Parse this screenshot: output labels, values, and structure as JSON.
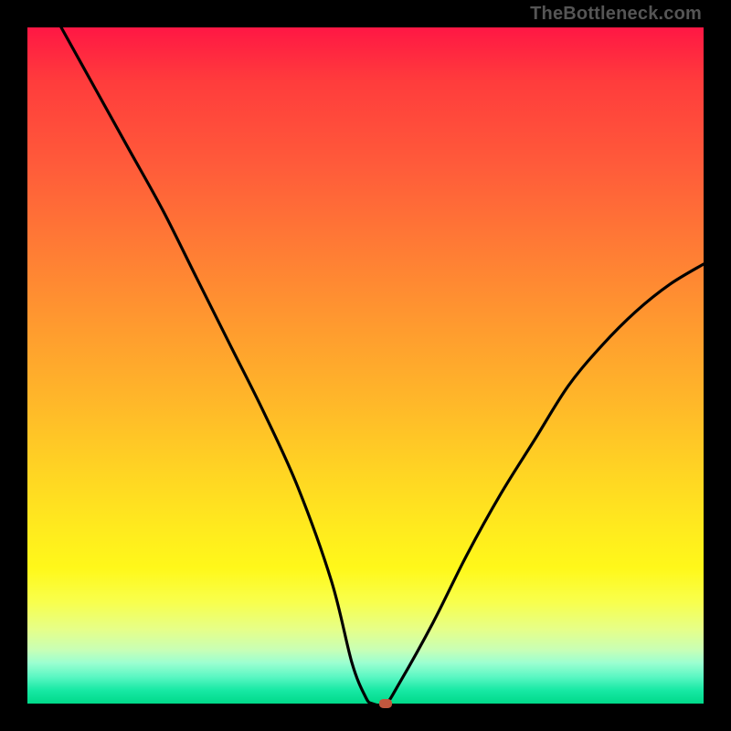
{
  "watermark": "TheBottleneck.com",
  "chart_data": {
    "type": "line",
    "title": "",
    "xlabel": "",
    "ylabel": "",
    "xlim": [
      0,
      100
    ],
    "ylim": [
      0,
      100
    ],
    "grid": false,
    "series": [
      {
        "name": "curve",
        "color": "#000000",
        "x": [
          5,
          10,
          15,
          20,
          25,
          30,
          35,
          40,
          45,
          48,
          50,
          51,
          53,
          55,
          60,
          65,
          70,
          75,
          80,
          85,
          90,
          95,
          100
        ],
        "y": [
          100,
          91,
          82,
          73,
          63,
          53,
          43,
          32,
          18,
          6,
          1,
          0,
          0,
          3,
          12,
          22,
          31,
          39,
          47,
          53,
          58,
          62,
          65
        ]
      }
    ],
    "marker": {
      "x": 53,
      "y": 0,
      "color": "#c1573e"
    },
    "background_gradient": {
      "stops": [
        {
          "pos": 0.0,
          "color": "#ff1744"
        },
        {
          "pos": 0.5,
          "color": "#ffb929"
        },
        {
          "pos": 0.8,
          "color": "#fff81a"
        },
        {
          "pos": 1.0,
          "color": "#00d989"
        }
      ]
    }
  }
}
